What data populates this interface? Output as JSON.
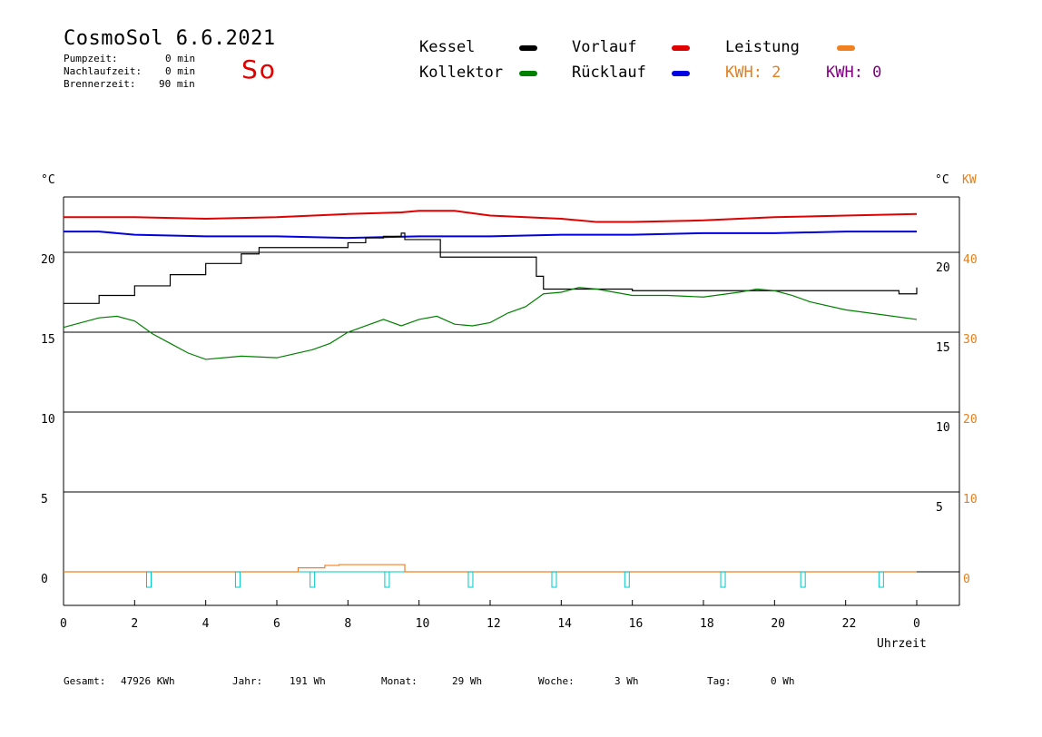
{
  "header": {
    "title": "CosmoSol 6.6.2021",
    "pumpzeit_label": "Pumpzeit:",
    "pumpzeit_value": "0 min",
    "nachlaufzeit_label": "Nachlaufzeit:",
    "nachlaufzeit_value": "0 min",
    "brennerzeit_label": "Brennerzeit:",
    "brennerzeit_value": "90 min",
    "weekday": "So"
  },
  "legend": {
    "kessel": "Kessel",
    "vorlauf": "Vorlauf",
    "leistung": "Leistung",
    "kollektor": "Kollektor",
    "ruecklauf": "Rücklauf",
    "kwh1": "KWH: 2",
    "kwh2": "KWH: 0",
    "colors": {
      "kessel": "#000000",
      "vorlauf": "#e00000",
      "leistung": "#f08020",
      "kollektor": "#008000",
      "ruecklauf": "#0000e0",
      "kwh1": "#e08020",
      "kwh2": "#800080",
      "pump": "#00c8c8"
    }
  },
  "axes": {
    "left_unit": "°C",
    "right_unit": "°C",
    "right_unit2": "KW",
    "xlabel": "Uhrzeit"
  },
  "footer": {
    "gesamt_label": "Gesamt:",
    "gesamt_value": "47926 KWh",
    "jahr_label": "Jahr:",
    "jahr_value": "191 Wh",
    "monat_label": "Monat:",
    "monat_value": "29 Wh",
    "woche_label": "Woche:",
    "woche_value": "3 Wh",
    "tag_label": "Tag:",
    "tag_value": "0 Wh"
  },
  "chart_data": {
    "type": "line",
    "x_ticks": [
      "0",
      "2",
      "4",
      "6",
      "8",
      "10",
      "12",
      "14",
      "16",
      "18",
      "20",
      "22",
      "0"
    ],
    "x_range": [
      0,
      24
    ],
    "y_left_ticks": [
      "20",
      "15",
      "10",
      "5",
      "0"
    ],
    "y_left_range": [
      -2,
      24.5
    ],
    "y_right_ticks": [
      "20",
      "15",
      "10",
      "5"
    ],
    "y_right2_ticks": [
      "40",
      "30",
      "20",
      "10",
      "0"
    ],
    "grid": true,
    "series": [
      {
        "name": "Vorlauf",
        "color": "#e00000",
        "x": [
          0,
          2,
          4,
          6,
          8,
          9.5,
          10,
          11,
          12,
          13,
          14,
          15,
          16,
          18,
          20,
          22,
          24
        ],
        "y": [
          22.2,
          22.2,
          22.1,
          22.2,
          22.4,
          22.5,
          22.6,
          22.6,
          22.3,
          22.2,
          22.1,
          21.9,
          21.9,
          22.0,
          22.2,
          22.3,
          22.4
        ]
      },
      {
        "name": "Rücklauf",
        "color": "#0000e0",
        "x": [
          0,
          1,
          2,
          4,
          6,
          8,
          10,
          12,
          14,
          16,
          18,
          20,
          22,
          24
        ],
        "y": [
          21.3,
          21.3,
          21.1,
          21.0,
          21.0,
          20.9,
          21.0,
          21.0,
          21.1,
          21.1,
          21.2,
          21.2,
          21.3,
          21.3
        ]
      },
      {
        "name": "Kessel",
        "color": "#000000",
        "x": [
          0,
          1,
          2,
          3,
          4,
          5,
          5.5,
          7.5,
          8,
          8.5,
          9,
          9.5,
          9.6,
          10.5,
          10.6,
          13.2,
          13.3,
          13.5,
          16,
          22,
          23.4,
          23.5,
          24
        ],
        "y": [
          16.8,
          17.3,
          17.9,
          18.6,
          19.3,
          19.9,
          20.3,
          20.3,
          20.6,
          20.9,
          21.0,
          21.2,
          20.8,
          20.8,
          19.7,
          19.7,
          18.5,
          17.7,
          17.6,
          17.6,
          17.6,
          17.4,
          17.8
        ]
      },
      {
        "name": "Kollektor",
        "color": "#008000",
        "x": [
          0,
          0.5,
          1,
          1.5,
          2,
          2.5,
          3,
          3.5,
          4,
          5,
          6,
          7,
          7.5,
          8,
          8.5,
          9,
          9.5,
          10,
          10.5,
          11,
          11.5,
          12,
          12.5,
          13,
          13.5,
          14,
          14.5,
          15,
          16,
          17,
          18,
          19,
          19.5,
          20,
          20.5,
          21,
          22,
          23,
          24
        ],
        "y": [
          15.3,
          15.6,
          15.9,
          16.0,
          15.7,
          14.9,
          14.3,
          13.7,
          13.3,
          13.5,
          13.4,
          13.9,
          14.3,
          15.0,
          15.4,
          15.8,
          15.4,
          15.8,
          16.0,
          15.5,
          15.4,
          15.6,
          16.2,
          16.6,
          17.4,
          17.5,
          17.8,
          17.7,
          17.3,
          17.3,
          17.2,
          17.5,
          17.7,
          17.6,
          17.3,
          16.9,
          16.4,
          16.1,
          15.8
        ]
      },
      {
        "name": "Leistung",
        "color": "#f08020",
        "x": [
          0,
          6.55,
          6.6,
          7.3,
          7.35,
          7.7,
          7.75,
          9.55,
          9.6,
          24
        ],
        "y": [
          0,
          0,
          0.25,
          0.25,
          0.4,
          0.4,
          0.45,
          0.45,
          0,
          0
        ]
      }
    ],
    "pump_markers_hours": [
      2.4,
      4.9,
      7.0,
      9.1,
      11.45,
      13.8,
      15.85,
      18.55,
      20.8,
      23.0
    ]
  }
}
